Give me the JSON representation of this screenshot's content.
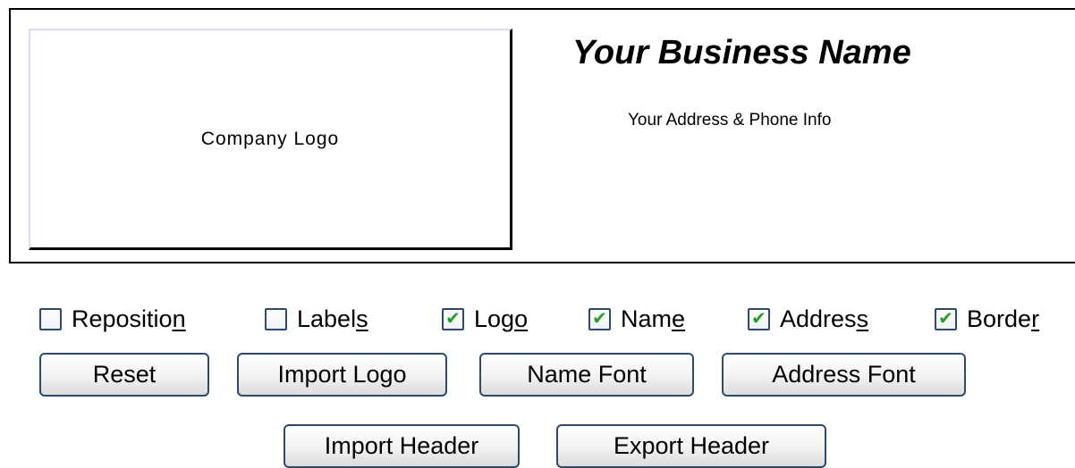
{
  "preview": {
    "logo_text": "Company Logo",
    "business_name": "Your Business Name",
    "address_info": "Your Address & Phone Info"
  },
  "options": [
    {
      "label_pre": "Repositio",
      "mnemonic": "n",
      "label_post": "",
      "checked": false
    },
    {
      "label_pre": "Label",
      "mnemonic": "s",
      "label_post": "",
      "checked": false
    },
    {
      "label_pre": "Log",
      "mnemonic": "o",
      "label_post": "",
      "checked": true
    },
    {
      "label_pre": "Nam",
      "mnemonic": "e",
      "label_post": "",
      "checked": true
    },
    {
      "label_pre": "Addres",
      "mnemonic": "s",
      "label_post": "",
      "checked": true
    },
    {
      "label_pre": "Borde",
      "mnemonic": "r",
      "label_post": "",
      "checked": true
    }
  ],
  "buttons": {
    "reset": "Reset",
    "import_logo": "Import Logo",
    "name_font": "Name Font",
    "address_font": "Address Font",
    "import_header": "Import Header",
    "export_header": "Export Header"
  },
  "check_glyph": "✔",
  "colors": {
    "border_accent": "#2a4a74",
    "check_green": "#22a022"
  }
}
